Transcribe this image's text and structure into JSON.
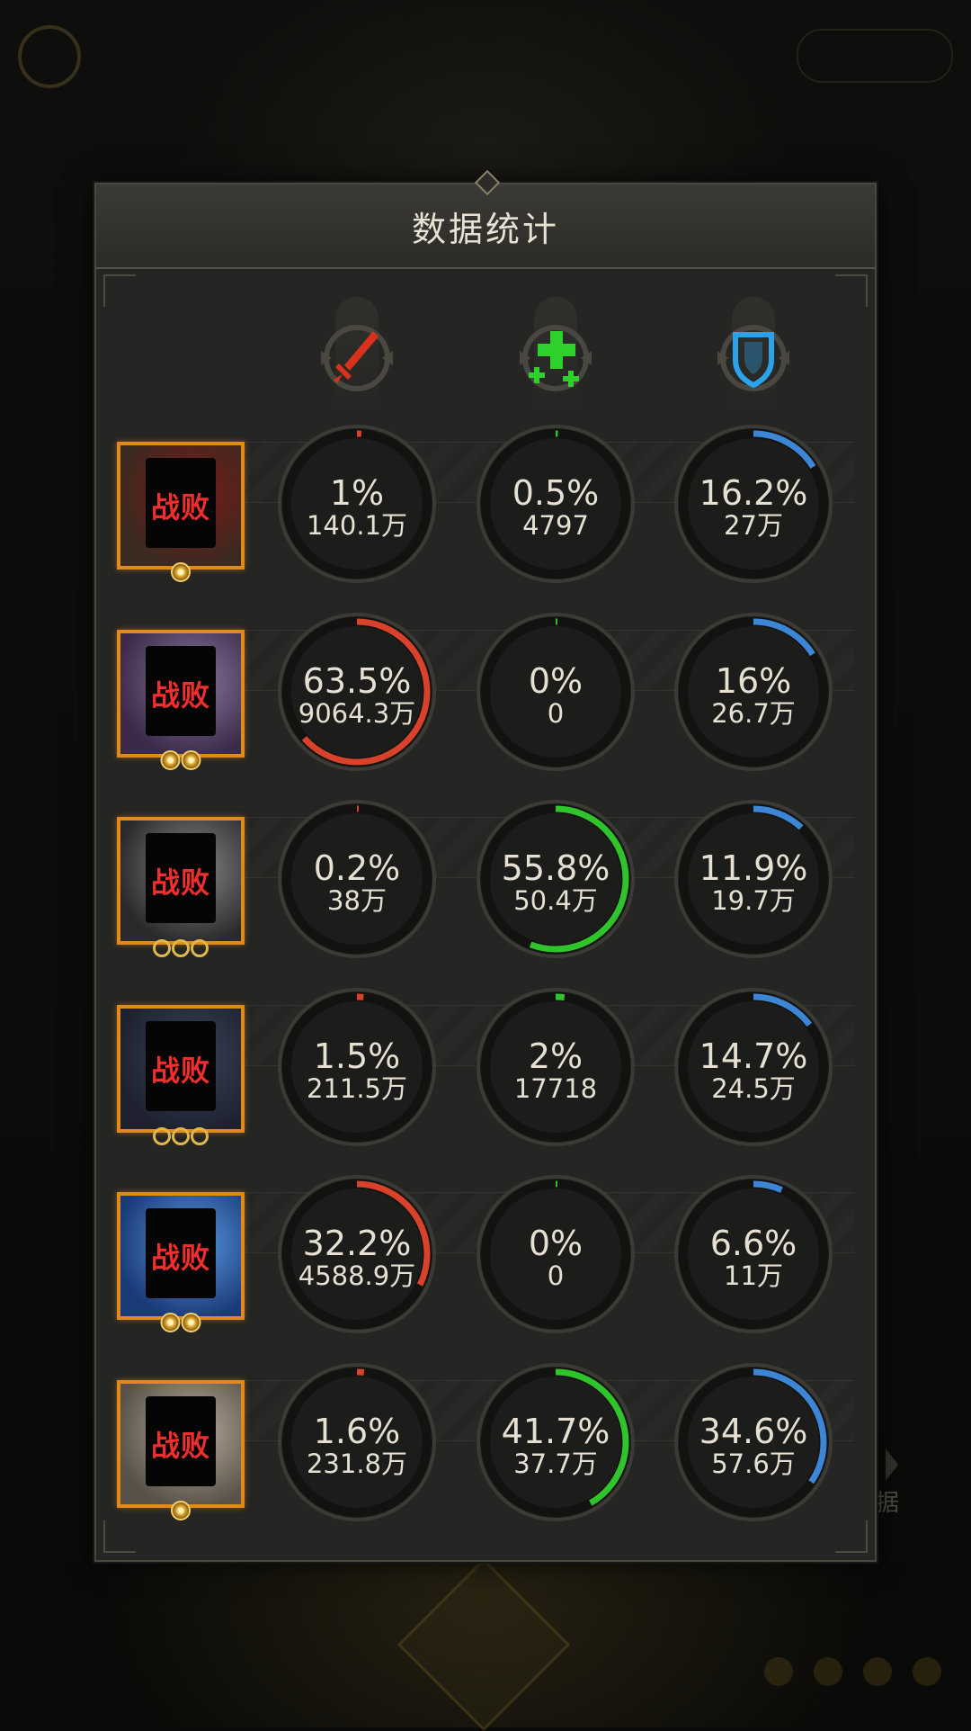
{
  "panel": {
    "title": "数据统计"
  },
  "background": {
    "side_label": "据"
  },
  "columns": [
    {
      "icon": "sword-damage-icon",
      "color": "#d8321e"
    },
    {
      "icon": "healing-plus-icon",
      "color": "#2fd02b"
    },
    {
      "icon": "shield-defense-icon",
      "color": "#2aa3ea"
    }
  ],
  "status_label": "战败",
  "rows": [
    {
      "portrait": "hero-portrait-1",
      "status": "战败",
      "stars": "sun",
      "damage": {
        "pct": "1%",
        "value": "140.1万",
        "fraction": 0.01
      },
      "heal": {
        "pct": "0.5%",
        "value": "4797",
        "fraction": 0.005
      },
      "tank": {
        "pct": "16.2%",
        "value": "27万",
        "fraction": 0.162
      }
    },
    {
      "portrait": "hero-portrait-2",
      "status": "战败",
      "stars": "sun-double",
      "damage": {
        "pct": "63.5%",
        "value": "9064.3万",
        "fraction": 0.635
      },
      "heal": {
        "pct": "0%",
        "value": "0",
        "fraction": 0
      },
      "tank": {
        "pct": "16%",
        "value": "26.7万",
        "fraction": 0.16
      }
    },
    {
      "portrait": "hero-portrait-3",
      "status": "战败",
      "stars": "rings-3",
      "damage": {
        "pct": "0.2%",
        "value": "38万",
        "fraction": 0.002
      },
      "heal": {
        "pct": "55.8%",
        "value": "50.4万",
        "fraction": 0.558
      },
      "tank": {
        "pct": "11.9%",
        "value": "19.7万",
        "fraction": 0.119
      }
    },
    {
      "portrait": "hero-portrait-4",
      "status": "战败",
      "stars": "rings-3",
      "damage": {
        "pct": "1.5%",
        "value": "211.5万",
        "fraction": 0.015
      },
      "heal": {
        "pct": "2%",
        "value": "17718",
        "fraction": 0.02
      },
      "tank": {
        "pct": "14.7%",
        "value": "24.5万",
        "fraction": 0.147
      }
    },
    {
      "portrait": "hero-portrait-5",
      "status": "战败",
      "stars": "sun-double",
      "damage": {
        "pct": "32.2%",
        "value": "4588.9万",
        "fraction": 0.322
      },
      "heal": {
        "pct": "0%",
        "value": "0",
        "fraction": 0
      },
      "tank": {
        "pct": "6.6%",
        "value": "11万",
        "fraction": 0.066
      }
    },
    {
      "portrait": "hero-portrait-6",
      "status": "战败",
      "stars": "sun",
      "damage": {
        "pct": "1.6%",
        "value": "231.8万",
        "fraction": 0.016
      },
      "heal": {
        "pct": "41.7%",
        "value": "37.7万",
        "fraction": 0.417
      },
      "tank": {
        "pct": "34.6%",
        "value": "57.6万",
        "fraction": 0.346
      }
    }
  ]
}
